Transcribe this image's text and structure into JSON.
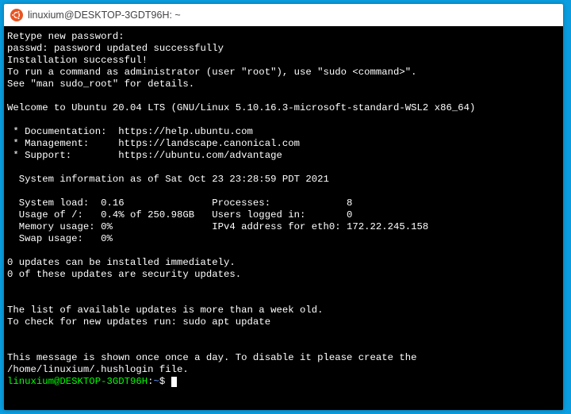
{
  "titlebar": {
    "title": "linuxium@DESKTOP-3GDT96H: ~"
  },
  "lines": {
    "l0": "Retype new password:",
    "l1": "passwd: password updated successfully",
    "l2": "Installation successful!",
    "l3": "To run a command as administrator (user \"root\"), use \"sudo <command>\".",
    "l4": "See \"man sudo_root\" for details.",
    "blank1": "",
    "l5": "Welcome to Ubuntu 20.04 LTS (GNU/Linux 5.10.16.3-microsoft-standard-WSL2 x86_64)",
    "blank2": "",
    "l6": " * Documentation:  https://help.ubuntu.com",
    "l7": " * Management:     https://landscape.canonical.com",
    "l8": " * Support:        https://ubuntu.com/advantage",
    "blank3": "",
    "l9": "  System information as of Sat Oct 23 23:28:59 PDT 2021",
    "blank4": "",
    "l10": "  System load:  0.16               Processes:             8",
    "l11": "  Usage of /:   0.4% of 250.98GB   Users logged in:       0",
    "l12": "  Memory usage: 0%                 IPv4 address for eth0: 172.22.245.158",
    "l13": "  Swap usage:   0%",
    "blank5": "",
    "l14": "0 updates can be installed immediately.",
    "l15": "0 of these updates are security updates.",
    "blank6": "",
    "blank7": "",
    "l16": "The list of available updates is more than a week old.",
    "l17": "To check for new updates run: sudo apt update",
    "blank8": "",
    "blank9": "",
    "l18": "This message is shown once once a day. To disable it please create the",
    "l19": "/home/linuxium/.hushlogin file."
  },
  "prompt": {
    "user": "linuxium@DESKTOP-3GDT96H",
    "colon": ":",
    "path": "~",
    "dollar": "$"
  }
}
